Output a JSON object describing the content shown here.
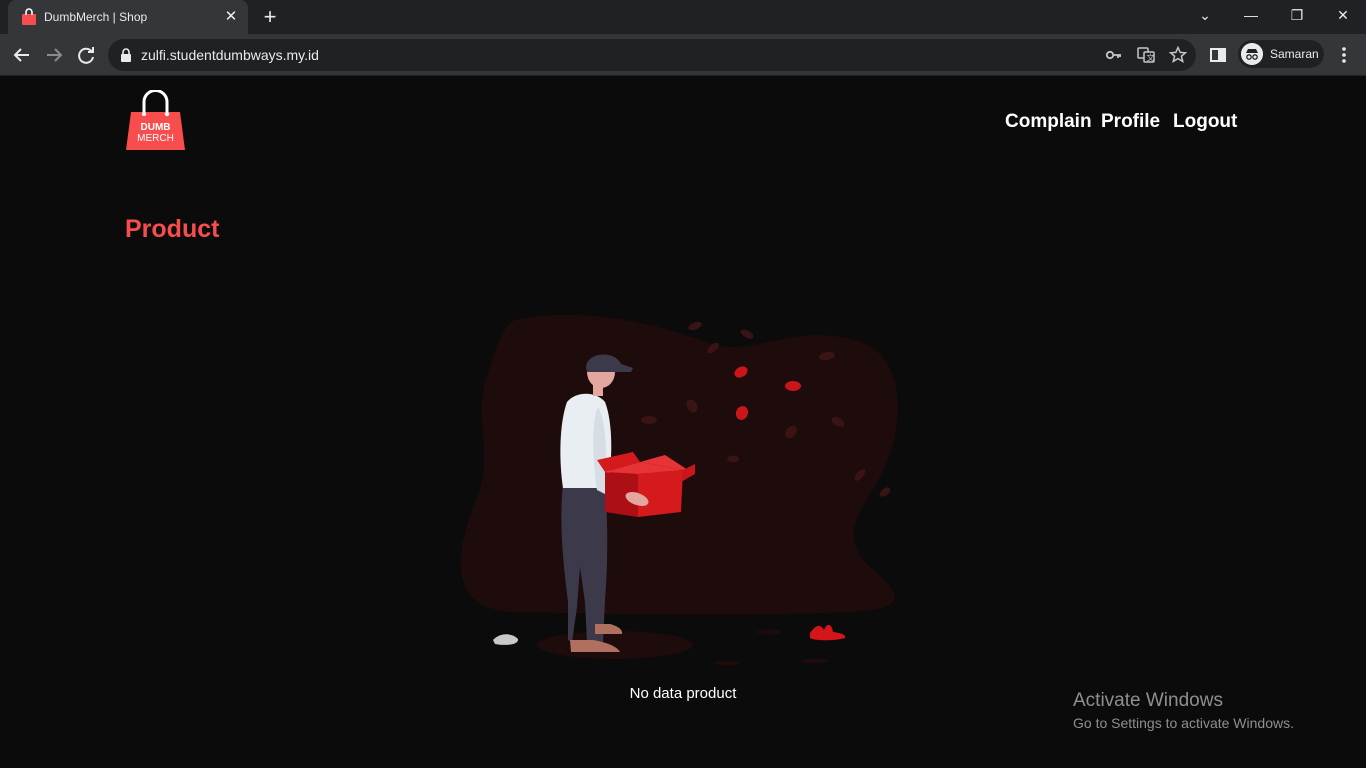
{
  "browser": {
    "tab_title": "DumbMerch | Shop",
    "tab_close": "✕",
    "new_tab": "+",
    "url": "zulfi.studentdumbways.my.id",
    "profile_label": "Samaran",
    "controls": {
      "minimize": "—",
      "restore": "❐",
      "close": "✕",
      "tab_search": "⌄"
    }
  },
  "header": {
    "logo_top": "DUMB",
    "logo_bottom": "MERCH",
    "nav": {
      "complain": "Complain",
      "profile": "Profile",
      "logout": "Logout"
    }
  },
  "main": {
    "title": "Product",
    "empty_message": "No data product"
  },
  "watermark": {
    "title": "Activate Windows",
    "subtitle": "Go to Settings to activate Windows."
  },
  "colors": {
    "accent": "#f74d4d",
    "background": "#0b0b0b"
  }
}
